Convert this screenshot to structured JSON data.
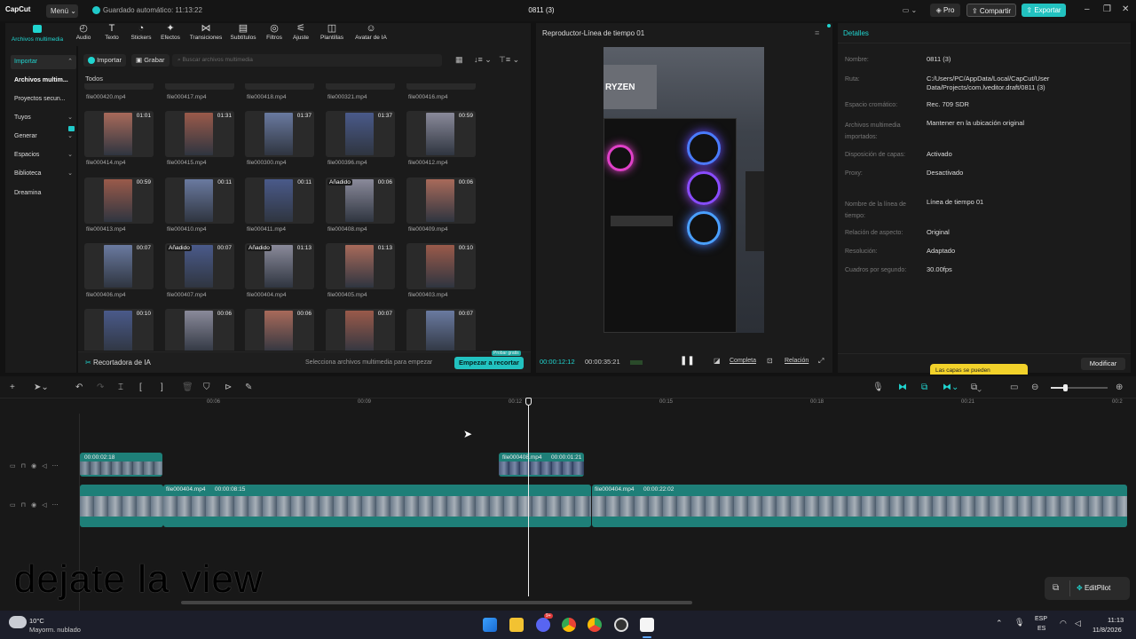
{
  "titlebar": {
    "logo": "CapCut",
    "menu_label": "Menú",
    "autosave": "Guardado automático: 11:13:22",
    "project_title": "0811 (3)",
    "pro_label": "Pro",
    "share_label": "Compartir",
    "export_label": "Exportar"
  },
  "toolbar": {
    "items": [
      {
        "label": "Archivos multimedia",
        "icon": "media-icon"
      },
      {
        "label": "Audio",
        "icon": "audio-icon"
      },
      {
        "label": "Texto",
        "icon": "text-icon"
      },
      {
        "label": "Stickers",
        "icon": "sticker-icon"
      },
      {
        "label": "Efectos",
        "icon": "effects-icon"
      },
      {
        "label": "Transiciones",
        "icon": "transitions-icon"
      },
      {
        "label": "Subtítulos",
        "icon": "subtitles-icon"
      },
      {
        "label": "Filtros",
        "icon": "filters-icon"
      },
      {
        "label": "Ajuste",
        "icon": "adjust-icon"
      },
      {
        "label": "Plantillas",
        "icon": "templates-icon"
      },
      {
        "label": "Avatar de IA",
        "icon": "avatar-icon"
      }
    ]
  },
  "leftnav": {
    "items": [
      {
        "label": "Importar"
      },
      {
        "label": "Archivos multim..."
      },
      {
        "label": "Proyectos secun..."
      },
      {
        "label": "Tuyos"
      },
      {
        "label": "Generar"
      },
      {
        "label": "Espacios"
      },
      {
        "label": "Biblioteca"
      },
      {
        "label": "Dreamina"
      }
    ]
  },
  "media": {
    "import_label": "Importar",
    "record_label": "Grabar",
    "search_placeholder": "Buscar archivos multimedia",
    "section_label": "Todos",
    "top_names": [
      "file000420.mp4",
      "file000417.mp4",
      "file000418.mp4",
      "file000321.mp4",
      "file000416.mp4"
    ],
    "rows": [
      [
        {
          "name": "file000414.mp4",
          "dur": "01:01",
          "added": ""
        },
        {
          "name": "file000415.mp4",
          "dur": "01:31",
          "added": ""
        },
        {
          "name": "file000300.mp4",
          "dur": "01:37",
          "added": ""
        },
        {
          "name": "file000396.mp4",
          "dur": "01:37",
          "added": ""
        },
        {
          "name": "file000412.mp4",
          "dur": "00:59",
          "added": ""
        }
      ],
      [
        {
          "name": "file000413.mp4",
          "dur": "00:59",
          "added": ""
        },
        {
          "name": "file000410.mp4",
          "dur": "00:11",
          "added": ""
        },
        {
          "name": "file000411.mp4",
          "dur": "00:11",
          "added": ""
        },
        {
          "name": "file000408.mp4",
          "dur": "00:06",
          "added": "Añadido"
        },
        {
          "name": "file000409.mp4",
          "dur": "00:06",
          "added": ""
        }
      ],
      [
        {
          "name": "file000406.mp4",
          "dur": "00:07",
          "added": ""
        },
        {
          "name": "file000407.mp4",
          "dur": "00:07",
          "added": "Añadido"
        },
        {
          "name": "file000404.mp4",
          "dur": "01:13",
          "added": "Añadido"
        },
        {
          "name": "file000405.mp4",
          "dur": "01:13",
          "added": ""
        },
        {
          "name": "file000403.mp4",
          "dur": "00:10",
          "added": ""
        }
      ],
      [
        {
          "name": "",
          "dur": "00:10",
          "added": ""
        },
        {
          "name": "",
          "dur": "00:06",
          "added": ""
        },
        {
          "name": "",
          "dur": "00:06",
          "added": ""
        },
        {
          "name": "",
          "dur": "00:07",
          "added": ""
        },
        {
          "name": "",
          "dur": "00:07",
          "added": ""
        }
      ]
    ],
    "ai_cutter_label": "Recortadora de IA",
    "ai_hint": "Selecciona archivos multimedia para empezar",
    "ai_badge": "Probar gratis",
    "ai_start_label": "Empezar a recortar"
  },
  "player": {
    "title": "Reproductor-Línea de tiempo 01",
    "current_time": "00:00:12:12",
    "total_time": "00:00:35:21",
    "full_label": "Completa",
    "ratio_label": "Relación"
  },
  "details": {
    "title": "Detalles",
    "rows": [
      {
        "label": "Nombre:",
        "value": "0811 (3)"
      },
      {
        "label": "Ruta:",
        "value": "C:/Users/PC/AppData/Local/CapCut/User Data/Projects/com.lveditor.draft/0811 (3)"
      },
      {
        "label": "Espacio cromático:",
        "value": "Rec. 709 SDR"
      },
      {
        "label": "Archivos multimedia importados:",
        "value": "Mantener en la ubicación original"
      },
      {
        "label": "Disposición de capas:",
        "value": "Activado"
      },
      {
        "label": "Proxy:",
        "value": "Desactivado"
      },
      {
        "label": "Nombre de la línea de tiempo:",
        "value": "Línea de tiempo 01"
      },
      {
        "label": "Relación de aspecto:",
        "value": "Original"
      },
      {
        "label": "Resolución:",
        "value": "Adaptado"
      },
      {
        "label": "Cuadros por segundo:",
        "value": "30.00fps"
      }
    ],
    "tooltip": "Las capas se pueden",
    "modify_label": "Modificar"
  },
  "timeline": {
    "ruler": [
      "00:06",
      "00:09",
      "00:12",
      "00:15",
      "00:18",
      "00:21",
      "00:2"
    ],
    "clips": {
      "upper_left_time": "00:00:02:18",
      "upper_right_name": "file000408.mp4",
      "upper_right_time": "00:00:01:21",
      "main_a_name": "file000404.mp4",
      "main_a_time": "00:00:08:15",
      "main_b_name": "file000404.mp4",
      "main_b_time": "00:00:22:02"
    },
    "overlay_text": "dejate la view",
    "editpilot_label": "EditPilot"
  },
  "taskbar": {
    "weather_temp": "10°C",
    "weather_desc": "Mayorm. nublado",
    "lang_top": "ESP",
    "lang_bottom": "ES",
    "time": "11:13",
    "date": "11/8/2026",
    "discord_badge": "9+"
  },
  "colors": {
    "accent": "#20d5d0",
    "clip_teal": "#1e7f78",
    "export": "#22c2c0"
  }
}
